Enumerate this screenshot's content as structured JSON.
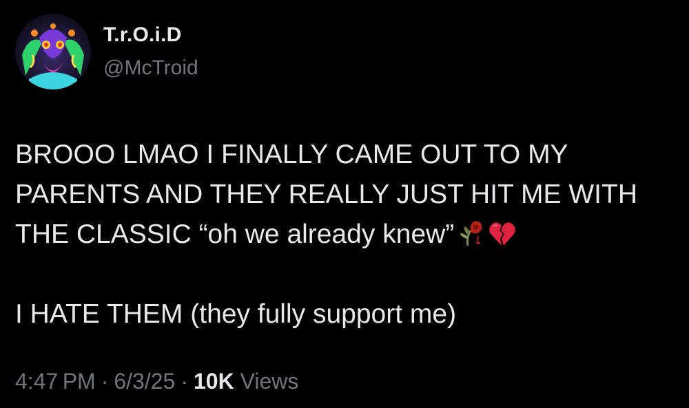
{
  "author": {
    "display_name": "T.r.O.i.D",
    "handle": "@McTroid",
    "avatar_icon": "neon-mask-avatar"
  },
  "tweet": {
    "lines": [
      "BROOO LMAO I FINALLY CAME OUT TO MY",
      "PARENTS AND THEY REALLY JUST HIT ME WITH",
      "THE CLASSIC “oh we already knew”"
    ],
    "emojis": [
      "wilted-flower-icon",
      "broken-heart-icon"
    ],
    "second_paragraph": "I HATE THEM (they fully support me)"
  },
  "meta": {
    "time": "4:47 PM",
    "separator": "·",
    "date": "6/3/25",
    "views_count": "10K",
    "views_label": "Views"
  },
  "colors": {
    "background": "#000000",
    "primary_text": "#e7e9ea",
    "secondary_text": "#71767b"
  }
}
